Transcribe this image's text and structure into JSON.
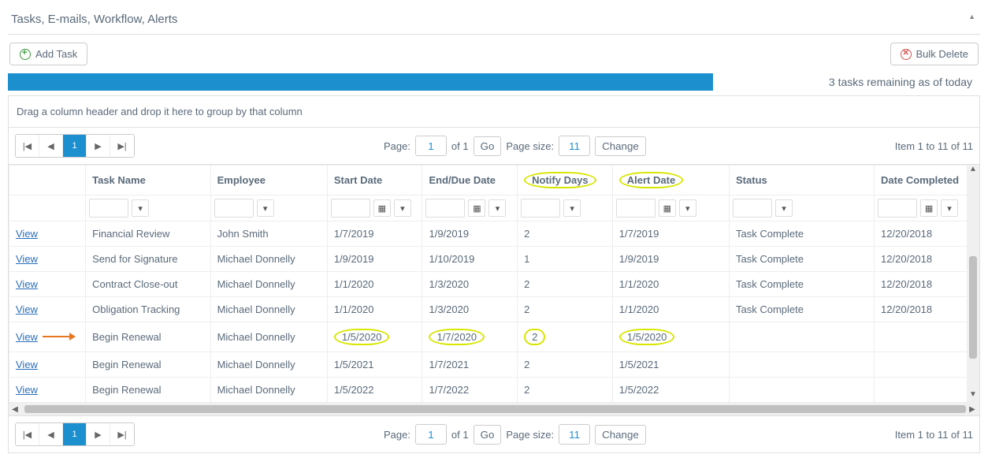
{
  "panel_title": "Tasks, E-mails, Workflow, Alerts",
  "toolbar": {
    "add_label": "Add Task",
    "bulk_delete_label": "Bulk Delete"
  },
  "remaining_text": "3 tasks remaining as of today",
  "group_drop_text": "Drag a column header and drop it here to group by that column",
  "pager": {
    "page_label": "Page:",
    "page_value": "1",
    "of_text": "of 1",
    "go_label": "Go",
    "pagesize_label": "Page size:",
    "pagesize_value": "11",
    "change_label": "Change",
    "item_text": "Item 1 to 11 of 11",
    "active_page": "1"
  },
  "columns": {
    "view": "",
    "task_name": "Task Name",
    "employee": "Employee",
    "start_date": "Start Date",
    "end_date": "End/Due Date",
    "notify_days": "Notify Days",
    "alert_date": "Alert Date",
    "status": "Status",
    "date_completed": "Date Completed"
  },
  "link_text": "View",
  "rows": [
    {
      "task": "Financial Review",
      "emp": "John Smith",
      "start": "1/7/2019",
      "end": "1/9/2019",
      "notify": "2",
      "alert": "1/7/2019",
      "status": "Task Complete",
      "completed": "12/20/2018",
      "emp_red": true,
      "highlight": false,
      "arrow": false
    },
    {
      "task": "Send for Signature",
      "emp": "Michael Donnelly",
      "start": "1/9/2019",
      "end": "1/10/2019",
      "notify": "1",
      "alert": "1/9/2019",
      "status": "Task Complete",
      "completed": "12/20/2018",
      "emp_red": false,
      "highlight": false,
      "arrow": false
    },
    {
      "task": "Contract Close-out",
      "emp": "Michael Donnelly",
      "start": "1/1/2020",
      "end": "1/3/2020",
      "notify": "2",
      "alert": "1/1/2020",
      "status": "Task Complete",
      "completed": "12/20/2018",
      "emp_red": false,
      "highlight": false,
      "arrow": false
    },
    {
      "task": "Obligation Tracking",
      "emp": "Michael Donnelly",
      "start": "1/1/2020",
      "end": "1/3/2020",
      "notify": "2",
      "alert": "1/1/2020",
      "status": "Task Complete",
      "completed": "12/20/2018",
      "emp_red": false,
      "highlight": false,
      "arrow": false
    },
    {
      "task": "Begin Renewal",
      "emp": "Michael Donnelly",
      "start": "1/5/2020",
      "end": "1/7/2020",
      "notify": "2",
      "alert": "1/5/2020",
      "status": "",
      "completed": "",
      "emp_red": false,
      "highlight": true,
      "arrow": true
    },
    {
      "task": "Begin Renewal",
      "emp": "Michael Donnelly",
      "start": "1/5/2021",
      "end": "1/7/2021",
      "notify": "2",
      "alert": "1/5/2021",
      "status": "",
      "completed": "",
      "emp_red": false,
      "highlight": false,
      "arrow": false
    },
    {
      "task": "Begin Renewal",
      "emp": "Michael Donnelly",
      "start": "1/5/2022",
      "end": "1/7/2022",
      "notify": "2",
      "alert": "1/5/2022",
      "status": "",
      "completed": "",
      "emp_red": false,
      "highlight": false,
      "arrow": false
    }
  ]
}
